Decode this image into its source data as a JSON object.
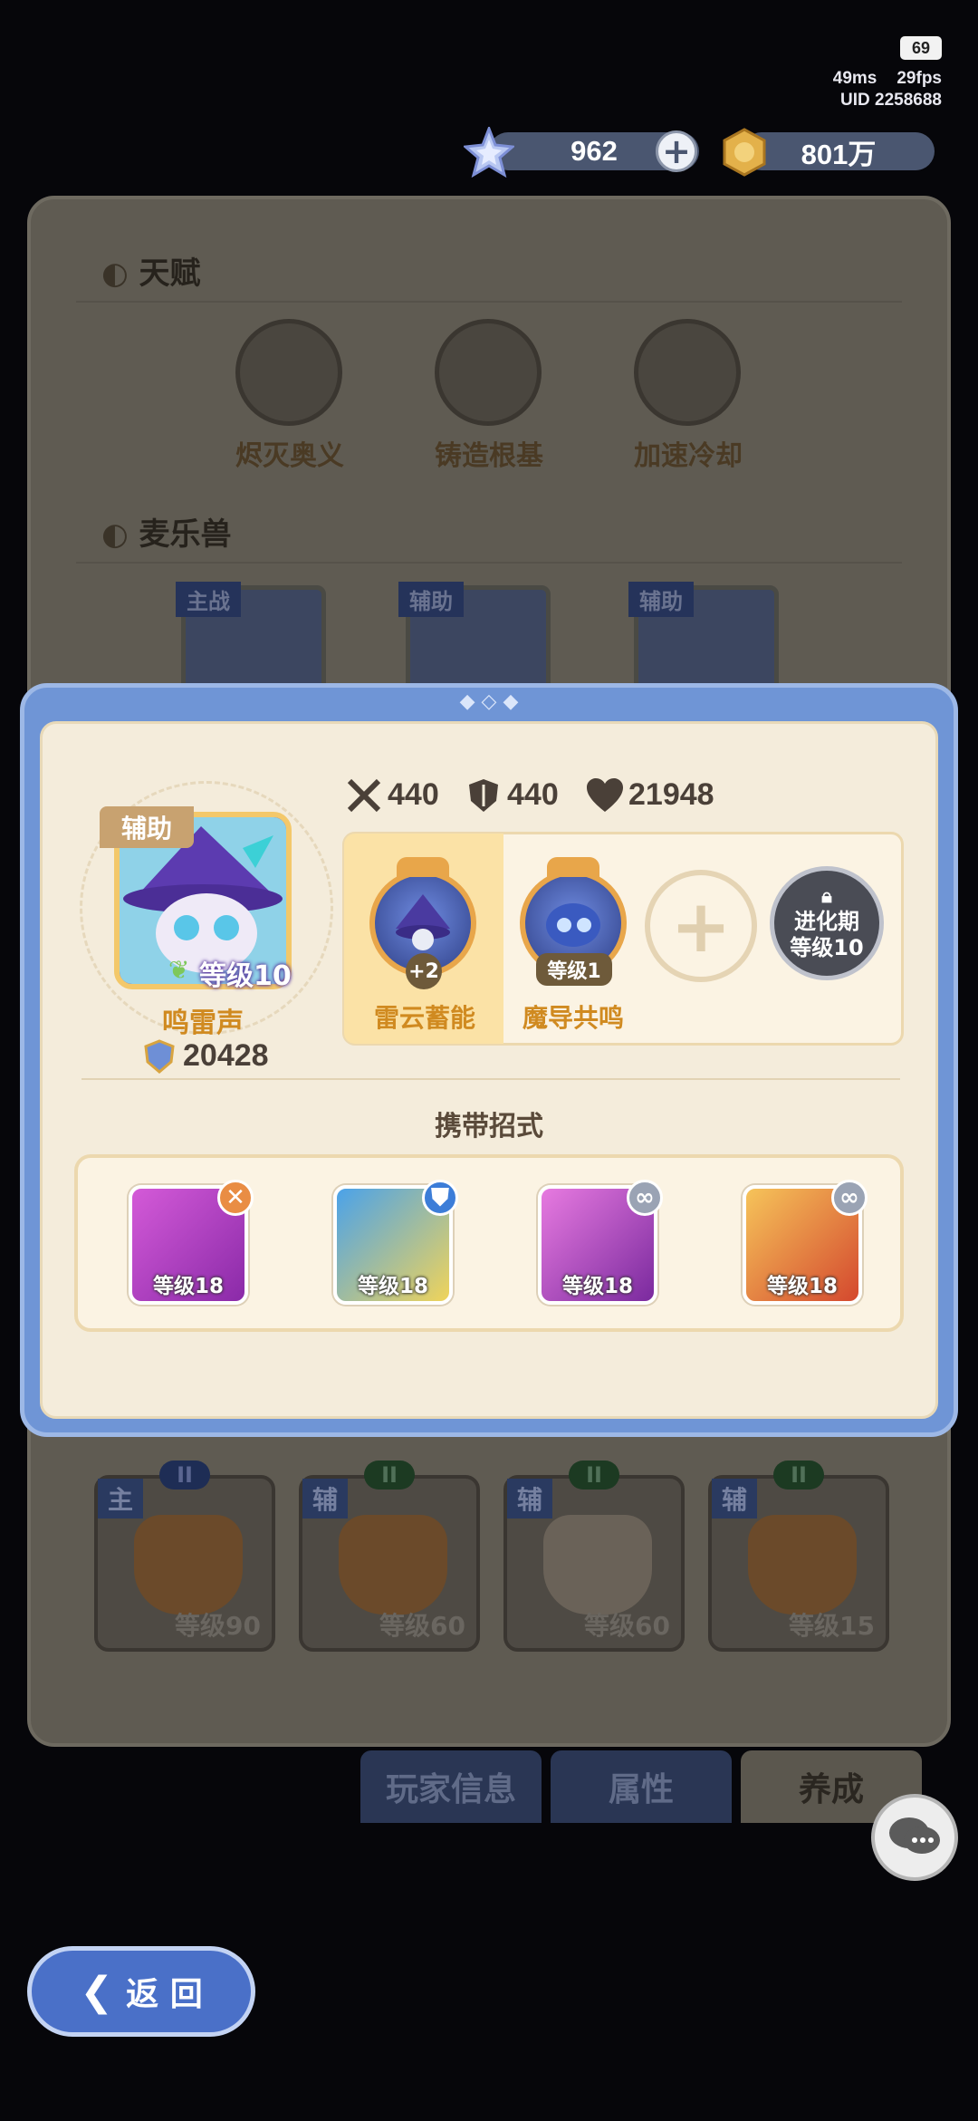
{
  "status": {
    "battery": "69",
    "ping": "49ms",
    "fps": "29fps",
    "uid": "UID  2258688"
  },
  "currency": {
    "gems": "962",
    "coins": "801万"
  },
  "background": {
    "talent_title": "天赋",
    "talents": [
      "烬灭奥义",
      "铸造根基",
      "加速冷却"
    ],
    "beasts_title": "麦乐兽",
    "beast_tags": [
      "主战",
      "辅助",
      "辅助"
    ],
    "team": [
      {
        "tag": "主",
        "rank": "II",
        "lv": "等级90"
      },
      {
        "tag": "辅",
        "rank": "II",
        "lv": "等级60"
      },
      {
        "tag": "辅",
        "rank": "II",
        "lv": "等级60"
      },
      {
        "tag": "辅",
        "rank": "II",
        "lv": "等级15"
      }
    ],
    "tabs": [
      "玩家信息",
      "属性",
      "养成"
    ]
  },
  "modal": {
    "role_tag": "辅助",
    "pet_level": "等级10",
    "pet_name": "鸣雷声",
    "power": "20428",
    "atk": "440",
    "def": "440",
    "hp": "21948",
    "traits": [
      {
        "name": "雷云蓄能",
        "badge": "+2"
      },
      {
        "name": "魔导共鸣",
        "badge": "等级1"
      }
    ],
    "locked_slot": [
      "进化期",
      "等级10"
    ],
    "moves_title": "携带招式",
    "moves": [
      {
        "lv": "等级18",
        "color": "#b53cc7",
        "badge_color": "#e98d44",
        "badge_icon": "✕"
      },
      {
        "lv": "等级18",
        "color": "#3d8fe0",
        "badge_color": "#3c7dd8",
        "badge_icon": "⛊"
      },
      {
        "lv": "等级18",
        "color": "#c04bc7",
        "badge_color": "#9aa3b4",
        "badge_icon": "∞"
      },
      {
        "lv": "等级18",
        "color": "#e0703a",
        "badge_color": "#9aa3b4",
        "badge_icon": "∞"
      }
    ]
  },
  "back_button": {
    "label": "返 回"
  }
}
